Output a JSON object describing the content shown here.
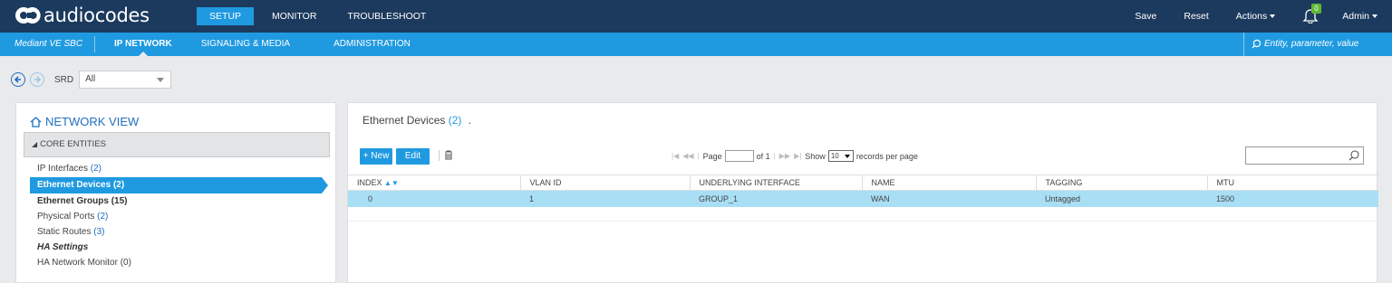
{
  "app": {
    "logo_text": "audiocodes",
    "top_tabs": [
      "SETUP",
      "MONITOR",
      "TROUBLESHOOT"
    ],
    "active_top_tab": "SETUP",
    "save_label": "Save",
    "reset_label": "Reset",
    "actions_label": "Actions",
    "notification_count": "0",
    "user_label": "Admin"
  },
  "subbar": {
    "device": "Mediant VE SBC",
    "tabs": [
      "IP NETWORK",
      "SIGNALING & MEDIA",
      "ADMINISTRATION"
    ],
    "search_placeholder": "Entity, parameter, value"
  },
  "srd": {
    "label": "SRD",
    "value": "All"
  },
  "network_view": {
    "title": "NETWORK VIEW",
    "section": "CORE ENTITIES",
    "items": [
      {
        "label": "IP Interfaces",
        "count": "(2)"
      },
      {
        "label": "Ethernet Devices",
        "count": "(2)"
      },
      {
        "label": "Ethernet Groups",
        "count": "(15)"
      },
      {
        "label": "Physical Ports",
        "count": "(2)"
      },
      {
        "label": "Static Routes",
        "count": "(3)"
      },
      {
        "label": "HA Settings",
        "count": ""
      },
      {
        "label": "HA Network Monitor",
        "count": "(0)"
      }
    ]
  },
  "main": {
    "title": "Ethernet Devices",
    "count": "(2)",
    "dot": ".",
    "new_label": "+ New",
    "edit_label": "Edit",
    "pager": {
      "page_label": "Page",
      "of_label": "of 1",
      "show_label": "Show",
      "per_page": "10",
      "records_label": "records per page"
    },
    "columns": [
      "INDEX",
      "VLAN ID",
      "UNDERLYING INTERFACE",
      "NAME",
      "TAGGING",
      "MTU"
    ],
    "rows": [
      [
        "0",
        "1",
        "GROUP_1",
        "WAN",
        "Untagged",
        "1500"
      ]
    ]
  },
  "colors": {
    "topbar": "#1c3a5e",
    "accent": "#1f9ae0",
    "selected_row": "#a9dff5"
  }
}
